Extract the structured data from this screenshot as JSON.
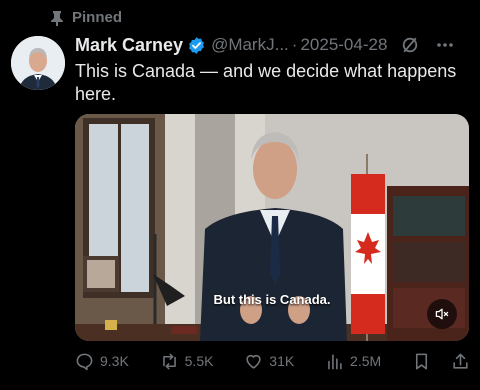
{
  "pinned": {
    "label": "Pinned",
    "icon": "pin-icon"
  },
  "author": {
    "name": "Mark Carney",
    "handle": "@MarkJ...",
    "separator": "·",
    "date": "2025-04-28",
    "verified_color": "#1d9bf0"
  },
  "tweet": {
    "text": "This is Canada — and we decide what happens here."
  },
  "media": {
    "caption": "But this is Canada.",
    "mute_icon": "speaker-muted-icon"
  },
  "actions": {
    "replies": "9.3K",
    "reposts": "5.5K",
    "likes": "31K",
    "views": "2.5M"
  },
  "colors": {
    "background": "#000000",
    "text_primary": "#e7e9ea",
    "text_secondary": "#71767b",
    "accent": "#1d9bf0"
  }
}
